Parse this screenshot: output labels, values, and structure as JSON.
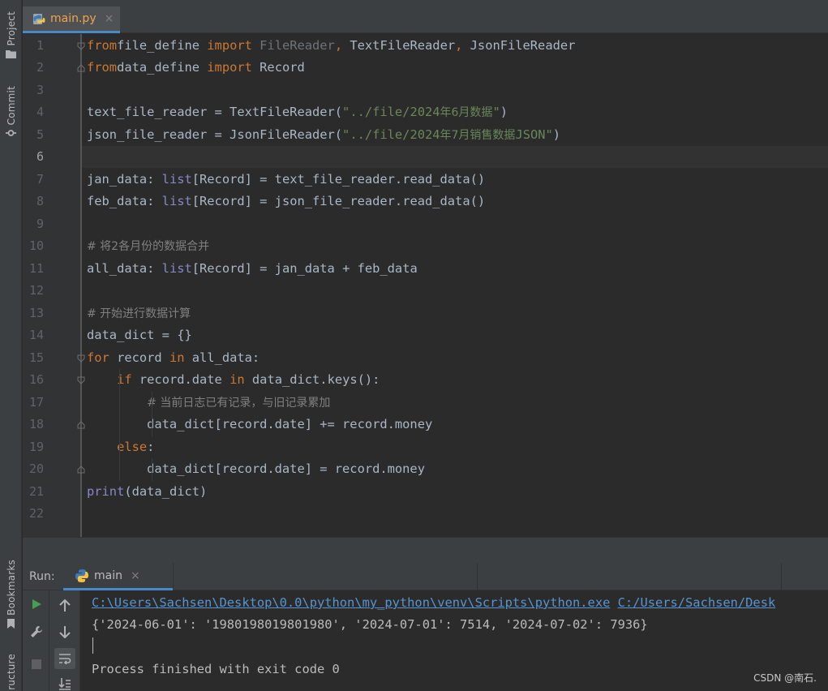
{
  "left_strip": {
    "project_label": "Project",
    "commit_label": "Commit",
    "bookmarks_label": "Bookmarks",
    "structure_label": "ructure"
  },
  "editor_tabs": [
    {
      "label": "main.py",
      "close": "×",
      "icon": "python-file-icon",
      "active": true
    }
  ],
  "editor": {
    "active_line": 6,
    "line_numbers": [
      "1",
      "2",
      "3",
      "4",
      "5",
      "6",
      "7",
      "8",
      "9",
      "10",
      "11",
      "12",
      "13",
      "14",
      "15",
      "16",
      "17",
      "18",
      "19",
      "20",
      "21",
      "22"
    ],
    "lines": [
      {
        "n": 1,
        "tokens": [
          [
            "kw",
            "from"
          ],
          [
            "",
            "file_define "
          ],
          [
            "kw",
            "import "
          ],
          [
            "dim",
            "FileReader"
          ],
          [
            "kw",
            ", "
          ],
          [
            "",
            "TextFileReader"
          ],
          [
            "kw",
            ", "
          ],
          [
            "",
            "JsonFileReader"
          ]
        ]
      },
      {
        "n": 2,
        "tokens": [
          [
            "kw",
            "from"
          ],
          [
            "",
            "data_define "
          ],
          [
            "kw",
            "import "
          ],
          [
            "",
            "Record"
          ]
        ]
      },
      {
        "n": 3,
        "tokens": []
      },
      {
        "n": 4,
        "tokens": [
          [
            "",
            "text_file_reader = TextFileReader("
          ],
          [
            "str",
            "\"../file/2024"
          ],
          [
            "strzh",
            "年6月数据"
          ],
          [
            "str",
            "\""
          ],
          [
            "",
            ")"
          ]
        ]
      },
      {
        "n": 5,
        "tokens": [
          [
            "",
            "json_file_reader = JsonFileReader("
          ],
          [
            "str",
            "\"../file/2024"
          ],
          [
            "strzh",
            "年7月销售数据"
          ],
          [
            "str",
            "JSON\""
          ],
          [
            "",
            ")"
          ]
        ]
      },
      {
        "n": 6,
        "tokens": []
      },
      {
        "n": 7,
        "tokens": [
          [
            "",
            "jan_data: "
          ],
          [
            "bi",
            "list"
          ],
          [
            "",
            "[Record] = text_file_reader.read_data()"
          ]
        ]
      },
      {
        "n": 8,
        "tokens": [
          [
            "",
            "feb_data: "
          ],
          [
            "bi",
            "list"
          ],
          [
            "",
            "[Record] = json_file_reader.read_data()"
          ]
        ]
      },
      {
        "n": 9,
        "tokens": []
      },
      {
        "n": 10,
        "tokens": [
          [
            "cm",
            "# 将2各月份的数据合并"
          ]
        ]
      },
      {
        "n": 11,
        "tokens": [
          [
            "",
            "all_data: "
          ],
          [
            "bi",
            "list"
          ],
          [
            "",
            "[Record] = jan_data + feb_data"
          ]
        ]
      },
      {
        "n": 12,
        "tokens": []
      },
      {
        "n": 13,
        "tokens": [
          [
            "cm",
            "# 开始进行数据计算"
          ]
        ]
      },
      {
        "n": 14,
        "tokens": [
          [
            "",
            "data_dict = {}"
          ]
        ]
      },
      {
        "n": 15,
        "tokens": [
          [
            "kw",
            "for "
          ],
          [
            "",
            "record "
          ],
          [
            "kw",
            "in "
          ],
          [
            "",
            "all_data:"
          ]
        ]
      },
      {
        "n": 16,
        "tokens": [
          [
            "",
            "    "
          ],
          [
            "kw",
            "if "
          ],
          [
            "",
            "record.date "
          ],
          [
            "kw",
            "in "
          ],
          [
            "",
            "data_dict.keys():"
          ]
        ]
      },
      {
        "n": 17,
        "tokens": [
          [
            "",
            "        "
          ],
          [
            "cm",
            "# 当前日志已有记录，与旧记录累加"
          ]
        ]
      },
      {
        "n": 18,
        "tokens": [
          [
            "",
            "        data_dict[record.date] += record.money"
          ]
        ]
      },
      {
        "n": 19,
        "tokens": [
          [
            "",
            "    "
          ],
          [
            "kw",
            "else"
          ],
          [
            "",
            ":"
          ]
        ]
      },
      {
        "n": 20,
        "tokens": [
          [
            "",
            "        data_dict[record.date] = record.money"
          ]
        ]
      },
      {
        "n": 21,
        "tokens": [
          [
            "bi",
            "print"
          ],
          [
            "",
            "(data_dict)"
          ]
        ]
      },
      {
        "n": 22,
        "tokens": []
      }
    ]
  },
  "run_panel": {
    "title": "Run:",
    "tab_label": "main",
    "tab_close": "×",
    "tools_left": [
      "run-icon",
      "wrench-icon",
      "stop-icon"
    ],
    "tools_right": [
      "arrow-up-icon",
      "arrow-down-icon",
      "soft-wrap-icon",
      "scroll-to-end-icon"
    ],
    "console": {
      "command_exe": "C:\\Users\\Sachsen\\Desktop\\0.0\\python\\my_python\\venv\\Scripts\\python.exe",
      "command_script": "C:/Users/Sachsen/Desk",
      "output": "{'2024-06-01': '1980198019801980', '2024-07-01': 7514, '2024-07-02': 7936}",
      "finish": "Process finished with exit code 0"
    }
  },
  "watermark": "CSDN @南石."
}
